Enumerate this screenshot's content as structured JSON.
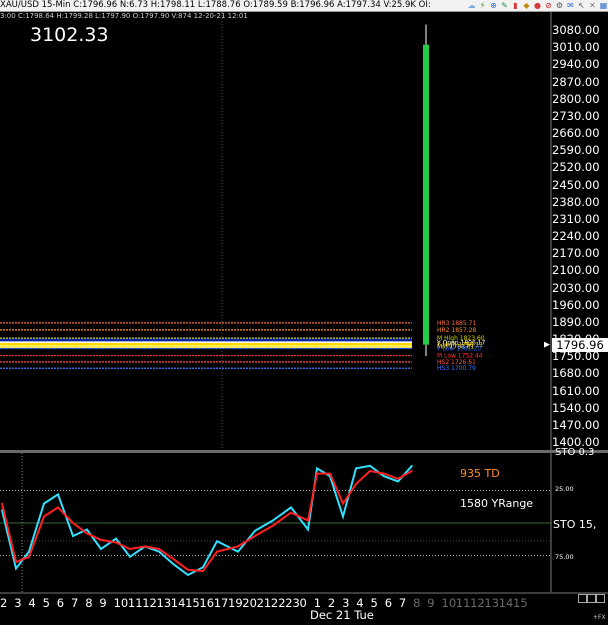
{
  "quote": {
    "symbol": "XAU/USD",
    "interval": "15-Min",
    "line1": "XAU/USD  15-Min  C:1796.96  N:6.73  H:1798.11  L:1788.76  O:1789.59  B:1796.96  A:1797.34  V:25.9K  OI:",
    "line2": "3:00  C:1798.64  H:1799.28  L:1797.90  O:1797.90  V:874  12-20-21  12:01"
  },
  "toolbar": {
    "icons": [
      "cloud-icon",
      "bolt-icon",
      "zoom-icon",
      "pencil-icon",
      "bar-chart-icon",
      "marker-icon",
      "drop-icon",
      "no-entry-icon",
      "gear-icon",
      "envelope-icon",
      "cursor-icon",
      "crosshair-icon",
      "grid-icon"
    ]
  },
  "big_price": "3102.33",
  "current_price": "1796.96",
  "price_axis": {
    "labels": [
      "3080.00",
      "3010.00",
      "2940.00",
      "2870.00",
      "2800.00",
      "2730.00",
      "2660.00",
      "2590.00",
      "2520.00",
      "2450.00",
      "2380.00",
      "2310.00",
      "2240.00",
      "2170.00",
      "2100.00",
      "2030.00",
      "1960.00",
      "1890.00",
      "1820.00",
      "1750.00",
      "1680.00",
      "1610.00",
      "1540.00",
      "1470.00",
      "1400.00"
    ],
    "min": 1400,
    "max": 3080,
    "last": 1796.96
  },
  "levels": [
    {
      "label": "HR3 1885.71",
      "value": 1885.71,
      "color": "#ff6a3a"
    },
    {
      "label": "HR2 1857.28",
      "value": 1857.28,
      "color": "#ff8c2a"
    },
    {
      "label": "M High 1823.60",
      "value": 1823.6,
      "color": "#d4d400"
    },
    {
      "label": "Y Open 1806.17",
      "value": 1806.17,
      "color": "#ffffff"
    },
    {
      "label": "Y High 1798.11",
      "value": 1798.11,
      "color": "#ffd800"
    },
    {
      "label": "Mid 1788.81",
      "value": 1788.81,
      "color": "#ffee55"
    },
    {
      "label": "Y Low 1781.20",
      "value": 1781.2,
      "color": "#2a66ff"
    },
    {
      "label": "M Low 1752.44",
      "value": 1752.44,
      "color": "#ff3030"
    },
    {
      "label": "HS2 1726.61",
      "value": 1726.61,
      "color": "#ff5050"
    },
    {
      "label": "HS3 1700.79",
      "value": 1700.79,
      "color": "#3a7aff"
    }
  ],
  "oscillator": {
    "td_label": "935 TD",
    "yrange_label": "1580 YRange",
    "sto_label": "STO  15,",
    "sto_clipped": "STO  0.3",
    "ticks": [
      "25.00",
      "75.00"
    ]
  },
  "chart_data": {
    "type": "line",
    "title": "",
    "xlabel": "",
    "ylabel": "",
    "x": [
      "2",
      "3",
      "4",
      "5",
      "6",
      "7",
      "8",
      "9",
      "10",
      "11",
      "12",
      "13",
      "14",
      "15",
      "16",
      "17",
      "19",
      "20",
      "21",
      "22",
      "23",
      "0",
      "1",
      "2",
      "3",
      "4",
      "5",
      "6",
      "7"
    ],
    "ylim": [
      0,
      100
    ],
    "series": [
      {
        "name": "",
        "color": "#33e0ff",
        "values": [
          40,
          85,
          72,
          35,
          28,
          60,
          55,
          70,
          62,
          76,
          68,
          72,
          82,
          90,
          84,
          64,
          72,
          56,
          48,
          38,
          55,
          8,
          14,
          45,
          8,
          6,
          14,
          18,
          6
        ]
      },
      {
        "name": "",
        "color": "#ff2020",
        "values": [
          35,
          80,
          76,
          45,
          38,
          50,
          58,
          63,
          65,
          70,
          68,
          70,
          78,
          86,
          87,
          72,
          68,
          60,
          52,
          42,
          48,
          12,
          12,
          35,
          20,
          10,
          12,
          16,
          10
        ]
      }
    ]
  },
  "x_axis": {
    "labels": [
      "2",
      "3",
      "4",
      "5",
      "6",
      "7",
      "8",
      "9",
      "10",
      "11",
      "12",
      "13",
      "14",
      "15",
      "16",
      "17",
      "19",
      "20",
      "21",
      "22",
      "23",
      "0",
      "1",
      "2",
      "3",
      "4",
      "5",
      "6",
      "7",
      "8",
      "9",
      "10",
      "11",
      "12",
      "13",
      "14",
      "15"
    ],
    "day_label": "Dec 21 Tue"
  },
  "corner_fx": "+FX"
}
